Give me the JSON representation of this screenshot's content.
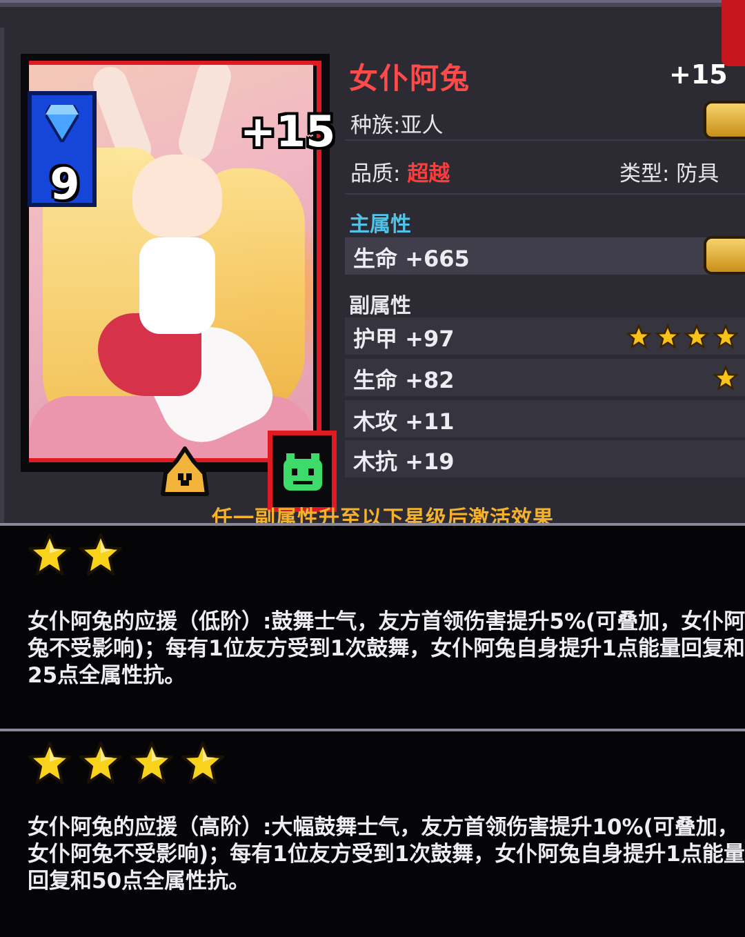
{
  "item": {
    "name": "女仆阿兔",
    "enhance_level": "+15",
    "card_level": "9",
    "race": "种族:亚人",
    "quality_label": "品质:",
    "quality_value": "超越",
    "type": "类型: 防具"
  },
  "main_attr": {
    "heading": "主属性",
    "stat": "生命 +665"
  },
  "sub_attr": {
    "heading": "副属性",
    "stats": [
      {
        "text": "护甲 +97",
        "stars": 4
      },
      {
        "text": "生命 +82",
        "stars": 1
      },
      {
        "text": "木攻 +11",
        "stars": 0
      },
      {
        "text": "木抗 +19",
        "stars": 0
      }
    ]
  },
  "activate_note": "任一副属性升至以下星级后激活效果",
  "effects": [
    {
      "stars": 2,
      "text": "女仆阿兔的应援（低阶）:鼓舞士气，友方首领伤害提升5%(可叠加，女仆阿兔不受影响)；每有1位友方受到1次鼓舞，女仆阿兔自身提升1点能量回复和25点全属性抗。"
    },
    {
      "stars": 4,
      "text": "女仆阿兔的应援（高阶）:大幅鼓舞士气，友方首领伤害提升10%(可叠加，女仆阿兔不受影响)；每有1位友方受到1次鼓舞，女仆阿兔自身提升1点能量回复和50点全属性抗。"
    }
  ],
  "colors": {
    "name_red": "#ff4a4a",
    "quality_red": "#ff3b3b",
    "main_attr_cyan": "#4fc4e8",
    "note_gold": "#f5b22a",
    "star_gold": "#f7c21a"
  }
}
